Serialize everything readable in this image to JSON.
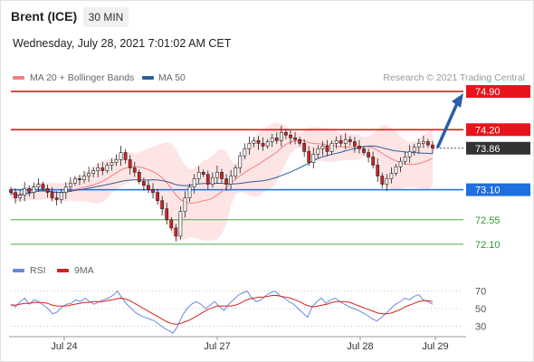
{
  "header": {
    "instrument": "Brent (ICE)",
    "timeframe": "30 MIN",
    "datetime": "Wednesday, July 28, 2021 7:01:02 AM CET"
  },
  "legend": {
    "ma20_bb": "MA 20 + Bollinger Bands",
    "ma50": "MA 50",
    "credit": "Research © 2021 Trading Central",
    "rsi": "RSI",
    "ma9": "9MA"
  },
  "colors": {
    "ma20": "#f08080",
    "ma50": "#2e5d9c",
    "bb_fill": "#fde0e0",
    "resistance": "#e8141b",
    "support": "#1e6fe0",
    "minor": "#2e9b2e",
    "current": "#333333",
    "up_candle": "#ffffff",
    "down_candle": "#d62020",
    "rsi": "#6688dd",
    "rsi_ma": "#d62020",
    "arrow": "#2a5ca8"
  },
  "chart_data": [
    {
      "type": "candlestick",
      "x_ticks": [
        "Jul 24",
        "Jul 27",
        "Jul 28",
        "Jul 29"
      ],
      "levels": [
        {
          "value": 74.9,
          "label": "74.90",
          "kind": "resistance"
        },
        {
          "value": 74.2,
          "label": "74.20",
          "kind": "resistance"
        },
        {
          "value": 73.86,
          "label": "73.86",
          "kind": "current"
        },
        {
          "value": 73.1,
          "label": "73.10",
          "kind": "support"
        },
        {
          "value": 72.55,
          "label": "72.55",
          "kind": "minor"
        },
        {
          "value": 72.1,
          "label": "72.10",
          "kind": "minor"
        }
      ],
      "ylim": [
        71.9,
        75.05
      ],
      "close_series": [
        73.05,
        72.95,
        73.0,
        73.12,
        73.05,
        73.15,
        73.2,
        73.12,
        73.05,
        72.95,
        72.92,
        73.05,
        73.15,
        73.22,
        73.3,
        73.28,
        73.35,
        73.4,
        73.45,
        73.5,
        73.45,
        73.55,
        73.6,
        73.65,
        73.78,
        73.65,
        73.5,
        73.42,
        73.25,
        73.18,
        73.1,
        73.05,
        72.9,
        72.75,
        72.55,
        72.4,
        72.25,
        72.7,
        72.95,
        73.15,
        73.3,
        73.42,
        73.38,
        73.2,
        73.32,
        73.42,
        73.3,
        73.2,
        73.35,
        73.5,
        73.72,
        73.85,
        73.95,
        74.0,
        73.95,
        73.9,
        73.98,
        74.05,
        74.0,
        74.15,
        74.1,
        74.05,
        74.02,
        73.95,
        73.8,
        73.6,
        73.75,
        73.85,
        73.9,
        73.8,
        73.95,
        74.0,
        73.95,
        74.02,
        73.98,
        73.9,
        73.85,
        73.78,
        73.7,
        73.55,
        73.35,
        73.2,
        73.3,
        73.4,
        73.52,
        73.62,
        73.7,
        73.8,
        73.88,
        73.95,
        73.98,
        73.92,
        73.86
      ],
      "forecast": {
        "from": 73.86,
        "to": 74.9
      }
    },
    {
      "type": "line",
      "name": "RSI",
      "ticks": [
        70,
        50,
        30
      ],
      "ylim": [
        20,
        80
      ],
      "rsi_series": [
        55,
        52,
        58,
        62,
        55,
        60,
        58,
        54,
        50,
        44,
        46,
        52,
        55,
        56,
        60,
        58,
        62,
        58,
        55,
        58,
        60,
        62,
        65,
        70,
        62,
        55,
        50,
        45,
        42,
        40,
        38,
        36,
        32,
        28,
        25,
        22,
        30,
        42,
        50,
        55,
        58,
        55,
        50,
        54,
        58,
        52,
        48,
        55,
        60,
        65,
        68,
        70,
        62,
        58,
        60,
        65,
        68,
        70,
        65,
        62,
        58,
        55,
        50,
        45,
        40,
        52,
        58,
        62,
        56,
        60,
        62,
        58,
        55,
        52,
        50,
        48,
        45,
        42,
        38,
        36,
        40,
        45,
        50,
        55,
        58,
        62,
        60,
        64,
        66,
        60,
        58,
        55
      ],
      "ma9_series": [
        54,
        54,
        55,
        56,
        56,
        57,
        57,
        57,
        56,
        54,
        53,
        53,
        53,
        54,
        55,
        56,
        57,
        57,
        58,
        58,
        58,
        59,
        60,
        61,
        62,
        61,
        59,
        56,
        53,
        50,
        47,
        44,
        41,
        38,
        35,
        33,
        32,
        33,
        35,
        37,
        40,
        43,
        46,
        49,
        51,
        53,
        53,
        53,
        53,
        54,
        56,
        59,
        61,
        62,
        63,
        63,
        64,
        65,
        65,
        64,
        63,
        62,
        60,
        58,
        55,
        53,
        52,
        53,
        54,
        55,
        57,
        58,
        58,
        58,
        57,
        55,
        53,
        51,
        49,
        47,
        45,
        44,
        44,
        45,
        47,
        49,
        52,
        54,
        56,
        58,
        59,
        59,
        58
      ]
    }
  ]
}
